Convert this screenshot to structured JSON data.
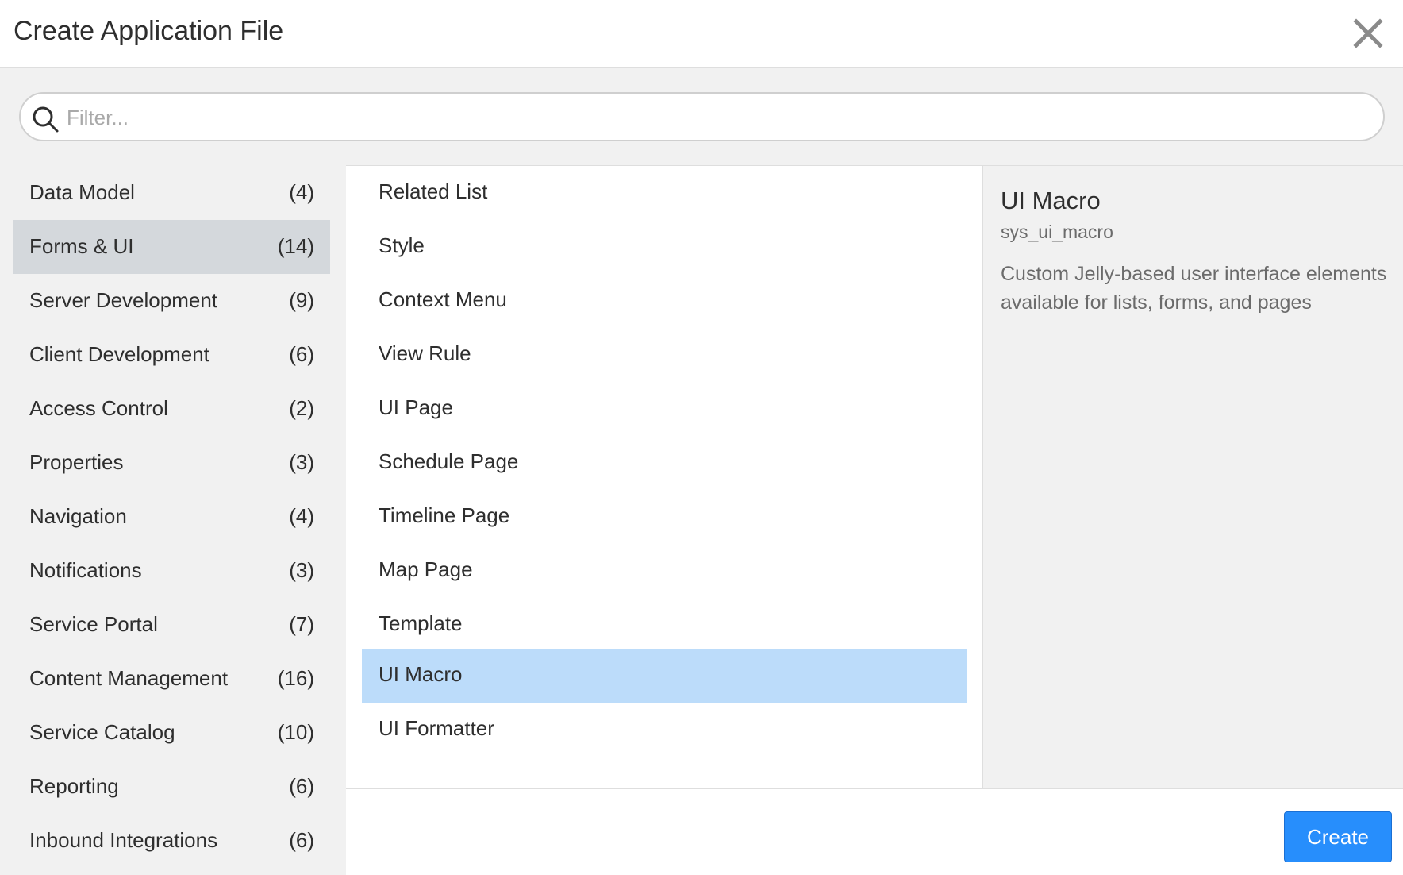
{
  "dialog": {
    "title": "Create Application File",
    "close_icon": "close-icon"
  },
  "filter": {
    "placeholder": "Filter...",
    "value": "",
    "icon": "search-icon"
  },
  "categories": [
    {
      "label": "Data Model",
      "count": "(4)"
    },
    {
      "label": "Forms & UI",
      "count": "(14)"
    },
    {
      "label": "Server Development",
      "count": "(9)"
    },
    {
      "label": "Client Development",
      "count": "(6)"
    },
    {
      "label": "Access Control",
      "count": "(2)"
    },
    {
      "label": "Properties",
      "count": "(3)"
    },
    {
      "label": "Navigation",
      "count": "(4)"
    },
    {
      "label": "Notifications",
      "count": "(3)"
    },
    {
      "label": "Service Portal",
      "count": "(7)"
    },
    {
      "label": "Content Management",
      "count": "(16)"
    },
    {
      "label": "Service Catalog",
      "count": "(10)"
    },
    {
      "label": "Reporting",
      "count": "(6)"
    },
    {
      "label": "Inbound Integrations",
      "count": "(6)"
    }
  ],
  "selected_category": "Forms & UI",
  "items": [
    {
      "label": "Related List"
    },
    {
      "label": "Style"
    },
    {
      "label": "Context Menu"
    },
    {
      "label": "View Rule"
    },
    {
      "label": "UI Page"
    },
    {
      "label": "Schedule Page"
    },
    {
      "label": "Timeline Page"
    },
    {
      "label": "Map Page"
    },
    {
      "label": "Template"
    },
    {
      "label": "UI Macro"
    },
    {
      "label": "UI Formatter"
    }
  ],
  "selected_item": "UI Macro",
  "detail": {
    "title": "UI Macro",
    "table": "sys_ui_macro",
    "description": "Custom Jelly-based user interface elements available for lists, forms, and pages"
  },
  "footer": {
    "create_label": "Create"
  },
  "colors": {
    "accent": "#278efc",
    "selected_item_bg": "#bcdcfa",
    "selected_category_bg": "#d4d8dc",
    "panel_bg": "#f1f1f1"
  }
}
